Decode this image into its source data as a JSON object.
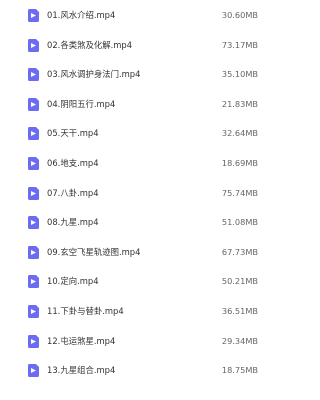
{
  "files": [
    {
      "name": "01.风水介绍.mp4",
      "size": "30.60MB"
    },
    {
      "name": "02.各类煞及化解.mp4",
      "size": "73.17MB"
    },
    {
      "name": "03.风水调护身法门.mp4",
      "size": "35.10MB"
    },
    {
      "name": "04.阴阳五行.mp4",
      "size": "21.83MB"
    },
    {
      "name": "05.天干.mp4",
      "size": "32.64MB"
    },
    {
      "name": "06.地支.mp4",
      "size": "18.69MB"
    },
    {
      "name": "07.八卦.mp4",
      "size": "75.74MB"
    },
    {
      "name": "08.九星.mp4",
      "size": "51.08MB"
    },
    {
      "name": "09.玄空飞星轨迹图.mp4",
      "size": "67.73MB"
    },
    {
      "name": "10.定向.mp4",
      "size": "50.21MB"
    },
    {
      "name": "11.下卦与替卦.mp4",
      "size": "36.51MB"
    },
    {
      "name": "12.屯运煞星.mp4",
      "size": "29.34MB"
    },
    {
      "name": "13.九星组合.mp4",
      "size": "18.75MB"
    }
  ],
  "icon": "video-file-icon",
  "colors": {
    "icon": "#6b6cf2",
    "name_text": "#333333",
    "size_text": "#666666"
  }
}
